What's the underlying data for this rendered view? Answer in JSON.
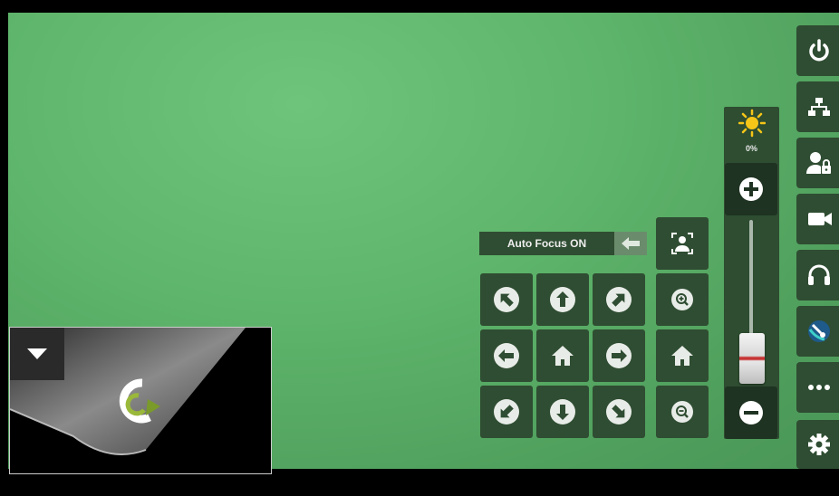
{
  "brightness": {
    "value_label": "0%",
    "level": 0.25
  },
  "auto_focus": {
    "label": "Auto Focus ON"
  },
  "ptz_pad": {
    "buttons": [
      {
        "name": "pan-up-left-button",
        "icon": "arrow-up-left-icon"
      },
      {
        "name": "pan-up-button",
        "icon": "arrow-up-icon"
      },
      {
        "name": "pan-up-right-button",
        "icon": "arrow-up-right-icon"
      },
      {
        "name": "pan-left-button",
        "icon": "arrow-left-icon"
      },
      {
        "name": "home-button",
        "icon": "home-icon"
      },
      {
        "name": "pan-right-button",
        "icon": "arrow-right-icon"
      },
      {
        "name": "pan-down-left-button",
        "icon": "arrow-down-left-icon"
      },
      {
        "name": "pan-down-button",
        "icon": "arrow-down-icon"
      },
      {
        "name": "pan-down-right-button",
        "icon": "arrow-down-right-icon"
      }
    ]
  },
  "zoom_column": [
    "person-frame-icon",
    "zoom-in-icon",
    "home-icon",
    "zoom-out-icon"
  ],
  "right_toolbar": [
    "power-icon",
    "network-icon",
    "user-lock-icon",
    "video-camera-icon",
    "headset-icon",
    "satellite-dish-icon",
    "more-icon",
    "gear-icon"
  ],
  "colors": {
    "button_bg": "#2f4d32",
    "accent_yellow": "#f5c518",
    "video_green": "#5eb56b"
  }
}
